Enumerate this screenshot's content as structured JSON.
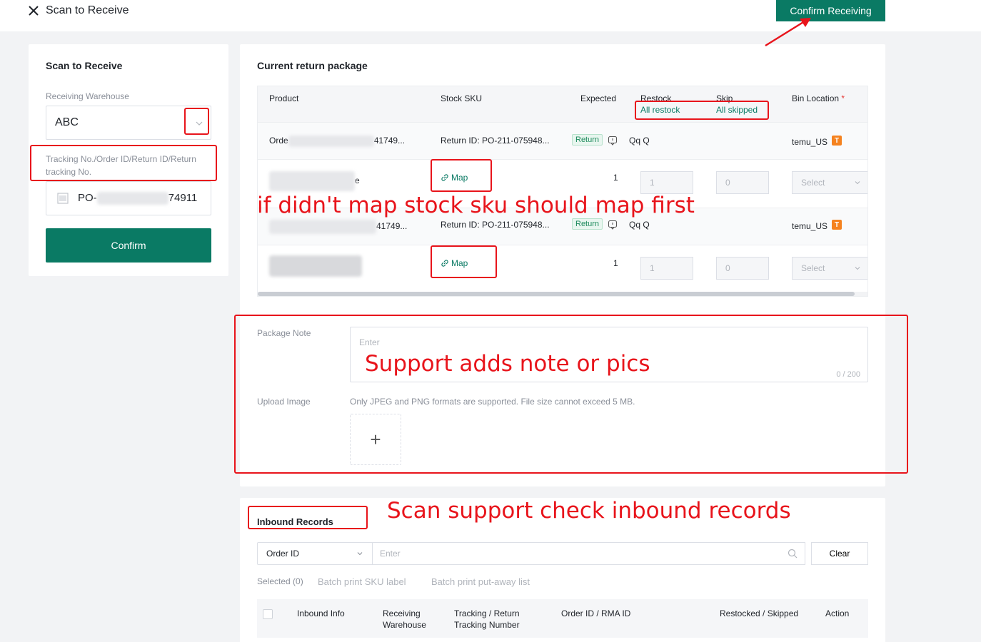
{
  "header": {
    "title": "Scan to Receive",
    "confirm_receiving": "Confirm Receiving"
  },
  "left_panel": {
    "title": "Scan to Receive",
    "warehouse_label": "Receiving Warehouse",
    "warehouse_value": "ABC",
    "tracking_label": "Tracking No./Order ID/Return ID/Return tracking No.",
    "tracking_prefix": "PO-",
    "tracking_suffix": "74911",
    "confirm_label": "Confirm"
  },
  "package": {
    "title": "Current return package",
    "columns": {
      "product": "Product",
      "stock_sku": "Stock SKU",
      "expected": "Expected",
      "restock": "Restock",
      "restock_all": "All restock",
      "skip": "Skip",
      "skip_all": "All skipped",
      "bin_location": "Bin Location",
      "required_mark": "*"
    },
    "orders": [
      {
        "order_prefix": "Orde",
        "order_suffix": "41749...",
        "return_id": "Return ID: PO-211-075948...",
        "tag": "Return",
        "buyer": "Qq Q",
        "store": "temu_US",
        "store_badge": "T",
        "item": {
          "product_fragment": "e",
          "map_label": "Map",
          "expected": "1",
          "restock": "1",
          "skip": "0",
          "bin_placeholder": "Select"
        }
      },
      {
        "order_prefix": "",
        "order_suffix": "41749...",
        "return_id": "Return ID: PO-211-075948...",
        "tag": "Return",
        "buyer": "Qq Q",
        "store": "temu_US",
        "store_badge": "T",
        "item": {
          "product_fragment": "",
          "map_label": "Map",
          "expected": "1",
          "restock": "1",
          "skip": "0",
          "bin_placeholder": "Select"
        }
      }
    ],
    "note_label": "Package Note",
    "note_placeholder": "Enter",
    "note_count": "0 / 200",
    "upload_label": "Upload Image",
    "upload_hint": "Only JPEG and PNG formats are supported. File size cannot exceed 5 MB.",
    "upload_plus": "+"
  },
  "inbound": {
    "title": "Inbound Records",
    "filter_type": "Order ID",
    "filter_placeholder": "Enter",
    "clear_label": "Clear",
    "selected": "Selected (0)",
    "batch_sku": "Batch print SKU label",
    "batch_putaway": "Batch print put-away list",
    "columns": {
      "info": "Inbound Info",
      "warehouse": "Receiving Warehouse",
      "tracking": "Tracking / Return Tracking Number",
      "order": "Order ID / RMA ID",
      "restocked": "Restocked / Skipped",
      "action": "Action"
    }
  },
  "annotations": {
    "map_first": "if didn't map stock sku should map first",
    "note_pics": "Support adds note or pics",
    "inbound_check": "Scan support check inbound records"
  },
  "colors": {
    "primary": "#0a7a64",
    "annotation": "#e8141b",
    "badge": "#f5821f"
  }
}
